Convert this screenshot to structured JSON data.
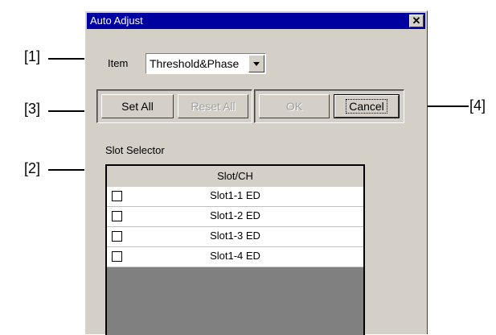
{
  "dialog": {
    "title": "Auto Adjust",
    "close_label": "✕",
    "item_label": "Item",
    "item_value": "Threshold&Phase",
    "buttons": {
      "set_all": "Set All",
      "reset_all": "Reset All",
      "ok": "OK",
      "cancel": "Cancel"
    },
    "slot_selector_label": "Slot Selector",
    "table": {
      "header": "Slot/CH",
      "rows": [
        {
          "label": "Slot1-1 ED",
          "checked": false
        },
        {
          "label": "Slot1-2 ED",
          "checked": false
        },
        {
          "label": "Slot1-3 ED",
          "checked": false
        },
        {
          "label": "Slot1-4 ED",
          "checked": false
        }
      ]
    }
  },
  "callouts": {
    "c1": "[1]",
    "c2": "[2]",
    "c3": "[3]",
    "c4": "[4]"
  }
}
